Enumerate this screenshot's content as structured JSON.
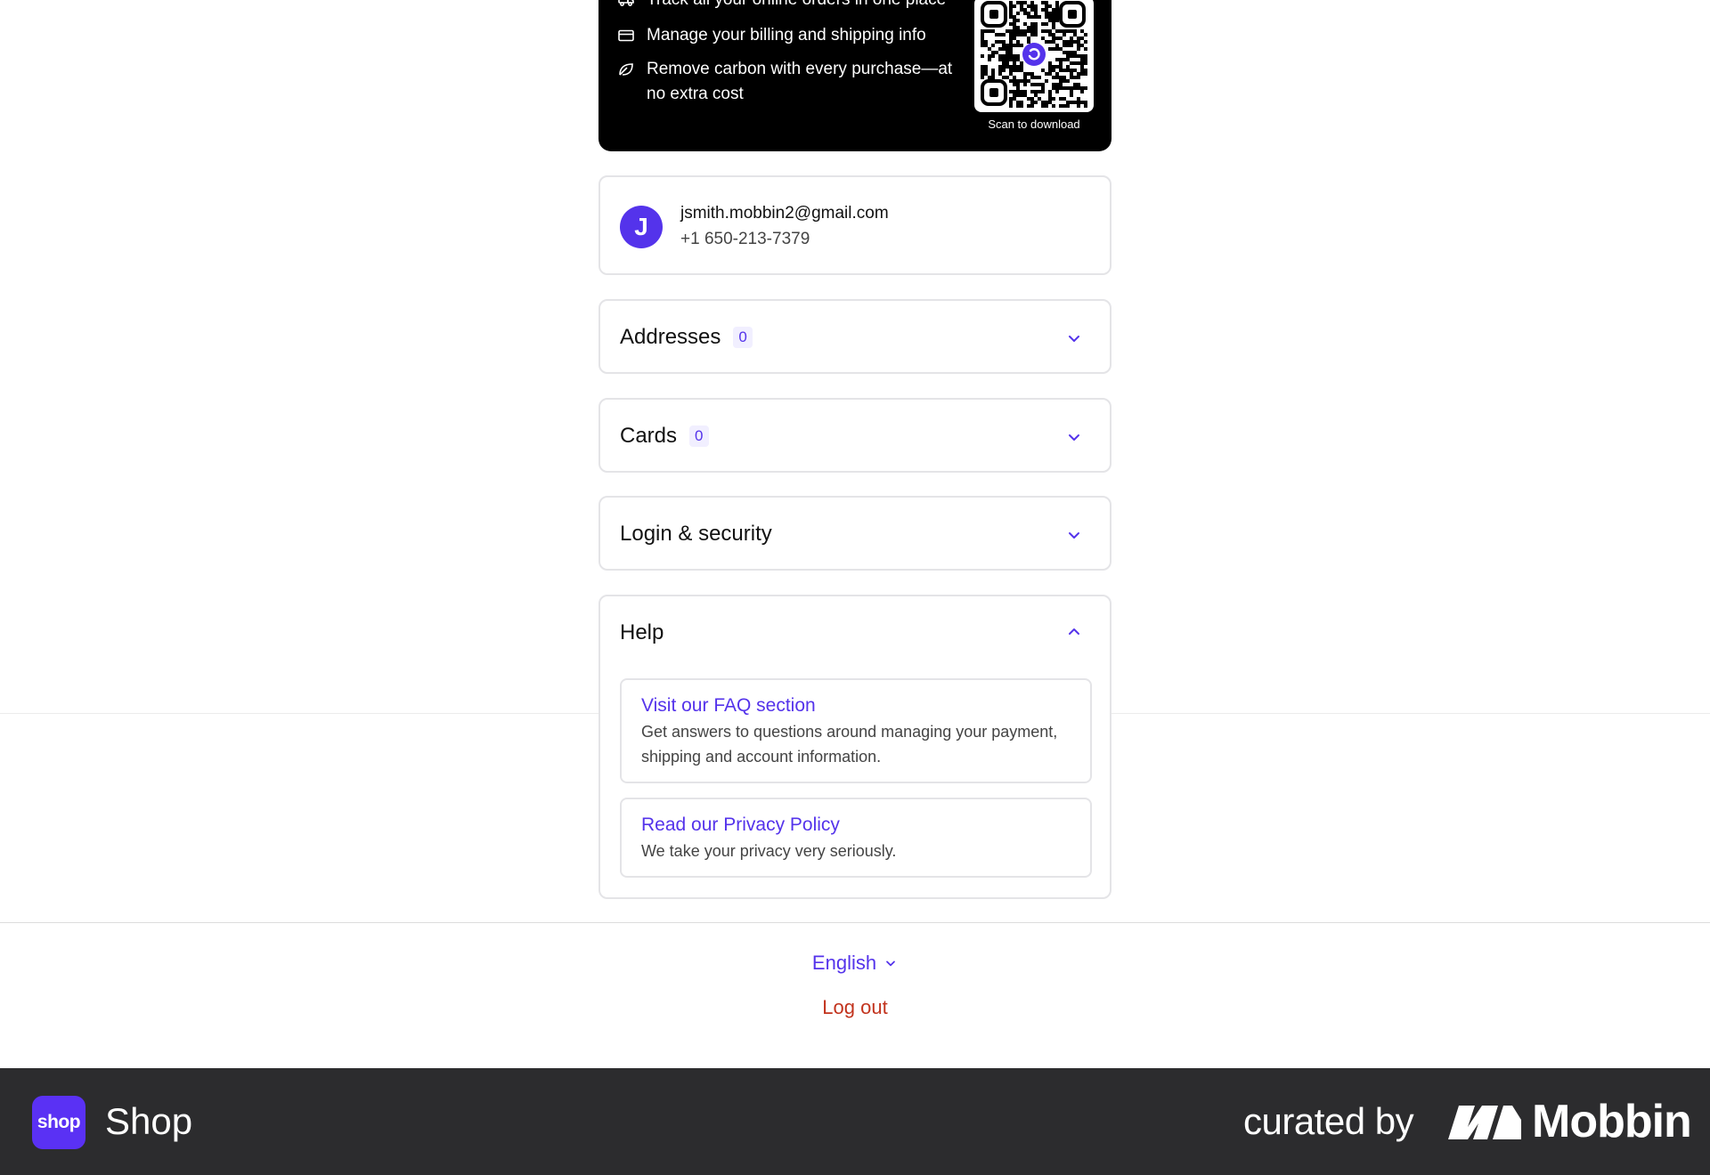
{
  "promo": {
    "items": [
      {
        "icon": "truck-icon",
        "text": "Track all your online orders in one place"
      },
      {
        "icon": "credit-card-icon",
        "text": "Manage your billing and shipping info"
      },
      {
        "icon": "leaf-icon",
        "text": "Remove carbon with every purchase—at no extra cost"
      }
    ],
    "qr_caption": "Scan to download"
  },
  "account": {
    "avatar_initial": "J",
    "email": "jsmith.mobbin2@gmail.com",
    "phone": "+1 650-213-7379"
  },
  "sections": {
    "addresses": {
      "label": "Addresses",
      "count": "0"
    },
    "cards": {
      "label": "Cards",
      "count": "0"
    },
    "login": {
      "label": "Login & security"
    },
    "help": {
      "label": "Help",
      "links": [
        {
          "title": "Visit our FAQ section",
          "desc": "Get answers to questions around managing your payment, shipping and account information."
        },
        {
          "title": "Read our Privacy Policy",
          "desc": "We take your privacy very seriously."
        }
      ]
    }
  },
  "footer": {
    "language": "English",
    "logout": "Log out"
  },
  "brand_bar": {
    "app_logo_text": "shop",
    "app_name": "Shop",
    "curated_by": "curated by",
    "mobbin": "Mobbin"
  },
  "colors": {
    "accent": "#5433eb",
    "logout": "#c2331d",
    "bar": "#2c2c2e"
  }
}
